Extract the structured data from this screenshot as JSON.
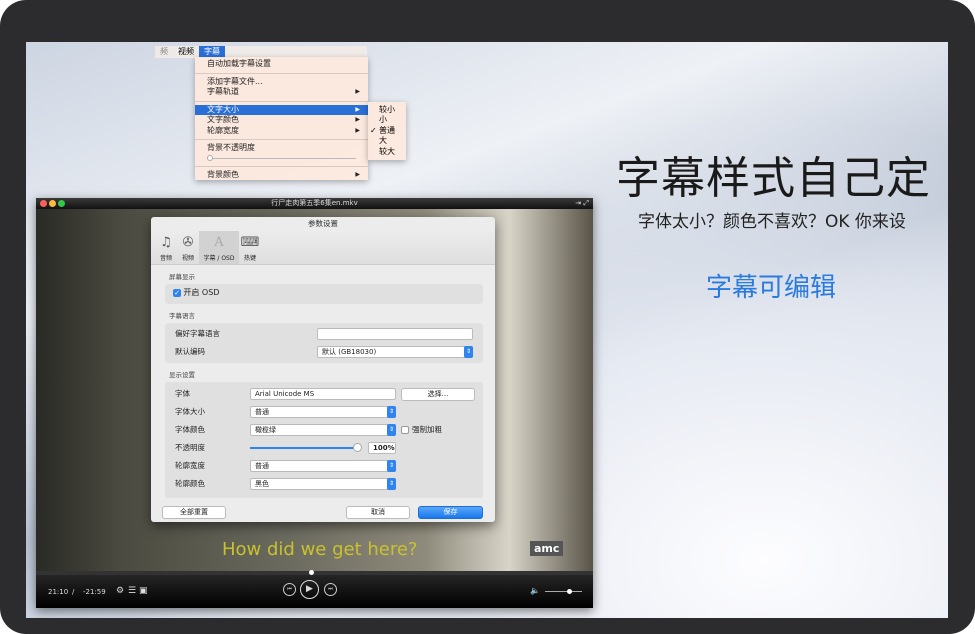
{
  "menubar": {
    "items": [
      "频",
      "视频",
      "字幕"
    ]
  },
  "menu": {
    "items": [
      {
        "label": "自动加载字幕设置"
      },
      {
        "label": "添加字幕文件..."
      },
      {
        "label": "字幕轨道",
        "arrow": "▶"
      },
      {
        "label": "文字大小",
        "arrow": "▶"
      },
      {
        "label": "文字颜色",
        "arrow": "▶"
      },
      {
        "label": "轮廓宽度",
        "arrow": "▶"
      },
      {
        "label": "背景不透明度"
      },
      {
        "label": "背景颜色",
        "arrow": "▶"
      }
    ],
    "bg_opacity_value": 0
  },
  "submenu": {
    "items": [
      "较小",
      "小",
      "普通",
      "大",
      "较大"
    ],
    "checked": "✓"
  },
  "hero": {
    "title": "字幕样式自己定",
    "subtitle": "字体太小？颜色不喜欢？OK 你来设",
    "tagline": "字幕可编辑"
  },
  "player": {
    "title": "行尸走肉第五季6集en.mkv",
    "subtitle": "How did we get here?",
    "logo": "amc",
    "elapsed": "21:10",
    "separator": "/",
    "remaining": "-21:59",
    "progress": 0.49,
    "volume": 0.6
  },
  "dialog": {
    "title": "参数设置",
    "tabs": [
      "音频",
      "视频",
      "字幕 / OSD",
      "热键"
    ],
    "osd_section": "屏幕显示",
    "osd_label": "开启 OSD",
    "osd_checked": true,
    "lang_section": "字幕语言",
    "pref_lang_label": "偏好字幕语言",
    "pref_lang_value": "",
    "encoding_label": "默认编码",
    "encoding_value": "默认 (GB18030)",
    "display_section": "显示设置",
    "font_label": "字体",
    "font_value": "Arial Unicode MS",
    "choose_button": "选择...",
    "size_label": "字体大小",
    "size_value": "普通",
    "color_label": "字体颜色",
    "color_value": "橄榄绿",
    "bold_label": "强制加粗",
    "opacity_label": "不透明度",
    "opacity_value": "100%",
    "outline_width_label": "轮廓宽度",
    "outline_width_value": "普通",
    "outline_color_label": "轮廓颜色",
    "outline_color_value": "黑色",
    "reset_button": "全部重置",
    "cancel_button": "取消",
    "save_button": "保存"
  },
  "colors": {
    "accent": "#2a7be0",
    "subtitle": "#c9c22e"
  }
}
